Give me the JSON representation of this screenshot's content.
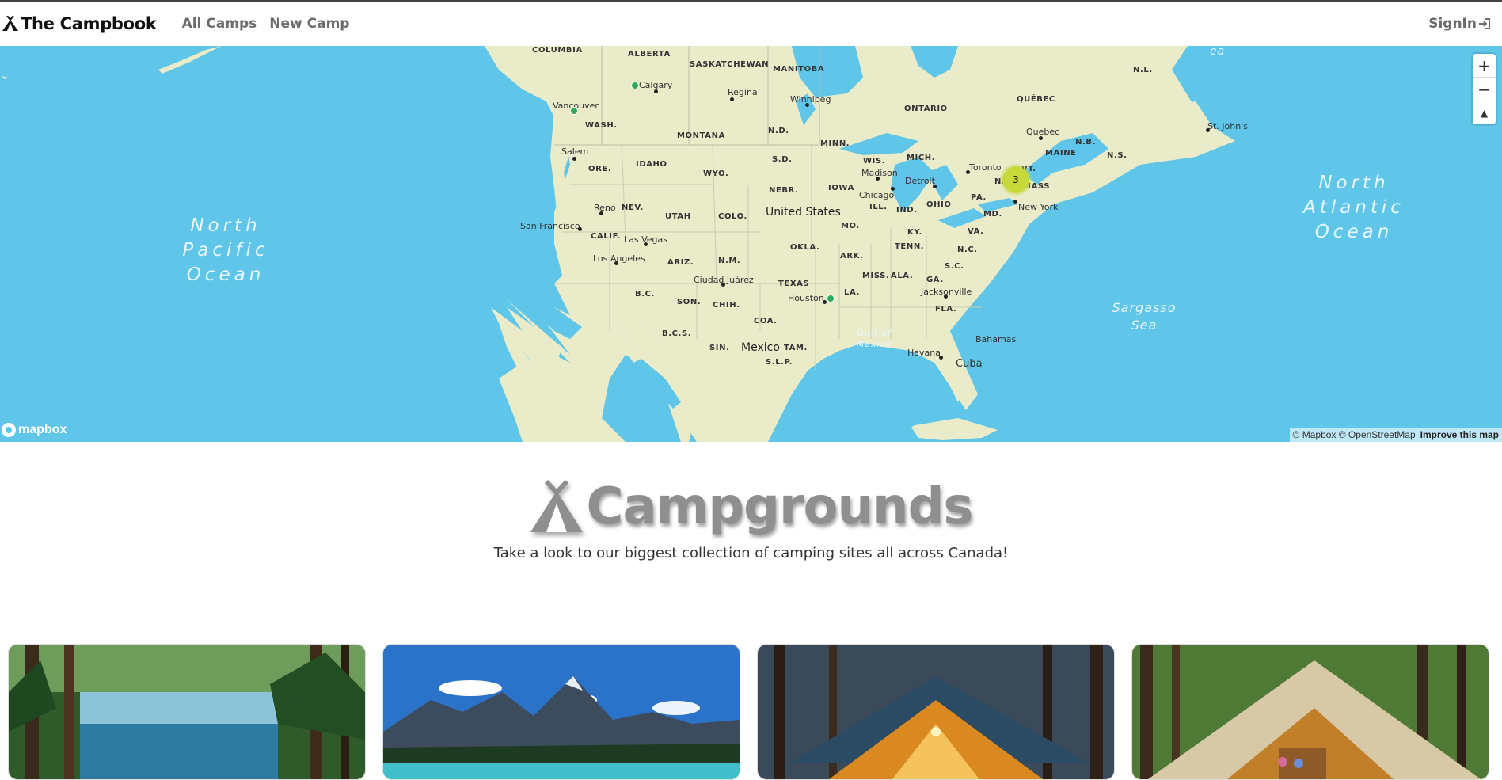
{
  "navbar": {
    "brand": "The Campbook",
    "links": [
      "All Camps",
      "New Camp"
    ],
    "signin": "SignIn"
  },
  "map": {
    "zoom_in": "+",
    "zoom_out": "−",
    "compass": "▲",
    "cluster_count": "3",
    "attribution": "© Mapbox © OpenStreetMap",
    "improve": "Improve this map",
    "logo": "mapbox",
    "labels": {
      "columbia": "COLUMBIA",
      "alberta": "ALBERTA",
      "saskatchewan": "SASKATCHEWAN",
      "manitoba": "MANITOBA",
      "ontario": "ONTARIO",
      "quebec_prov": "QUÉBEC",
      "nl": "N.L.",
      "nb": "N.B.",
      "ns": "N.S.",
      "wash": "WASH.",
      "montana": "MONTANA",
      "nd": "N.D.",
      "minn": "MINN.",
      "ore": "ORE.",
      "idaho": "IDAHO",
      "wyo": "WYO.",
      "sd": "S.D.",
      "wis": "WIS.",
      "mich": "MICH.",
      "maine": "MAINE",
      "vt": "VT.",
      "nebr": "NEBR.",
      "iowa": "IOWA",
      "ny": "N.Y.",
      "mass": "MASS",
      "nev": "NEV.",
      "utah": "UTAH",
      "colo": "COLO.",
      "ill": "ILL.",
      "ind": "IND.",
      "ohio": "OHIO",
      "pa": "PA.",
      "md": "MD.",
      "calif": "CALIF.",
      "mo": "MO.",
      "ky": "KY.",
      "va": "VA.",
      "ariz": "ARIZ.",
      "nm": "N.M.",
      "okla": "OKLA.",
      "tenn": "TENN.",
      "nc": "N.C.",
      "ark": "ARK.",
      "sc": "S.C.",
      "texas": "TEXAS",
      "miss": "MISS.",
      "ala": "ALA.",
      "ga": "GA.",
      "la": "LA.",
      "bc": "B.C.",
      "son": "SON.",
      "chih": "CHIH.",
      "coa": "COA.",
      "fla": "FLA.",
      "bcs": "B.C.S.",
      "sin": "SIN.",
      "tam": "TAM.",
      "slp": "S.L.P."
    },
    "cities": {
      "calgary": "Calgary",
      "vancouver": "Vancouver",
      "regina": "Regina",
      "winnipeg": "Winnipeg",
      "stjohns": "St. John's",
      "quebec": "Quebec",
      "toronto": "Toronto",
      "salem": "Salem",
      "madison": "Madison",
      "detroit": "Detroit",
      "chicago": "Chicago",
      "newyork": "New York",
      "reno": "Reno",
      "sanfrancisco": "San Francisco",
      "lasvegas": "Las Vegas",
      "losangeles": "Los Angeles",
      "ciudadjuarez": "Ciudad Juárez",
      "houston": "Houston",
      "jacksonville": "Jacksonville",
      "bahamas": "Bahamas",
      "havana": "Havana",
      "cuba": "Cuba"
    },
    "countries": {
      "us": "United States",
      "mexico": "Mexico"
    },
    "water": {
      "north_pacific": [
        "North",
        "Pacific",
        "Ocean"
      ],
      "north_atlantic": [
        "North",
        "Atlantic",
        "Ocean"
      ],
      "sargasso": [
        "Sargasso",
        "Sea"
      ],
      "gulf": [
        "Gulf of",
        "Mexico"
      ],
      "edge": "ea"
    }
  },
  "hero": {
    "title": "Campgrounds",
    "subtitle": "Take a look to our biggest collection of camping sites all across Canada!"
  },
  "cards": [
    {
      "scene": "forest-lake"
    },
    {
      "scene": "mountain-lake"
    },
    {
      "scene": "lit-tent-cabin"
    },
    {
      "scene": "canvas-tent-forest"
    }
  ],
  "colors": {
    "water": "#5fc6ea",
    "land": "#e9ebc9",
    "cluster": "#c7d93a",
    "marker": "#2eab5a",
    "nav_link": "#6c6c6c"
  }
}
